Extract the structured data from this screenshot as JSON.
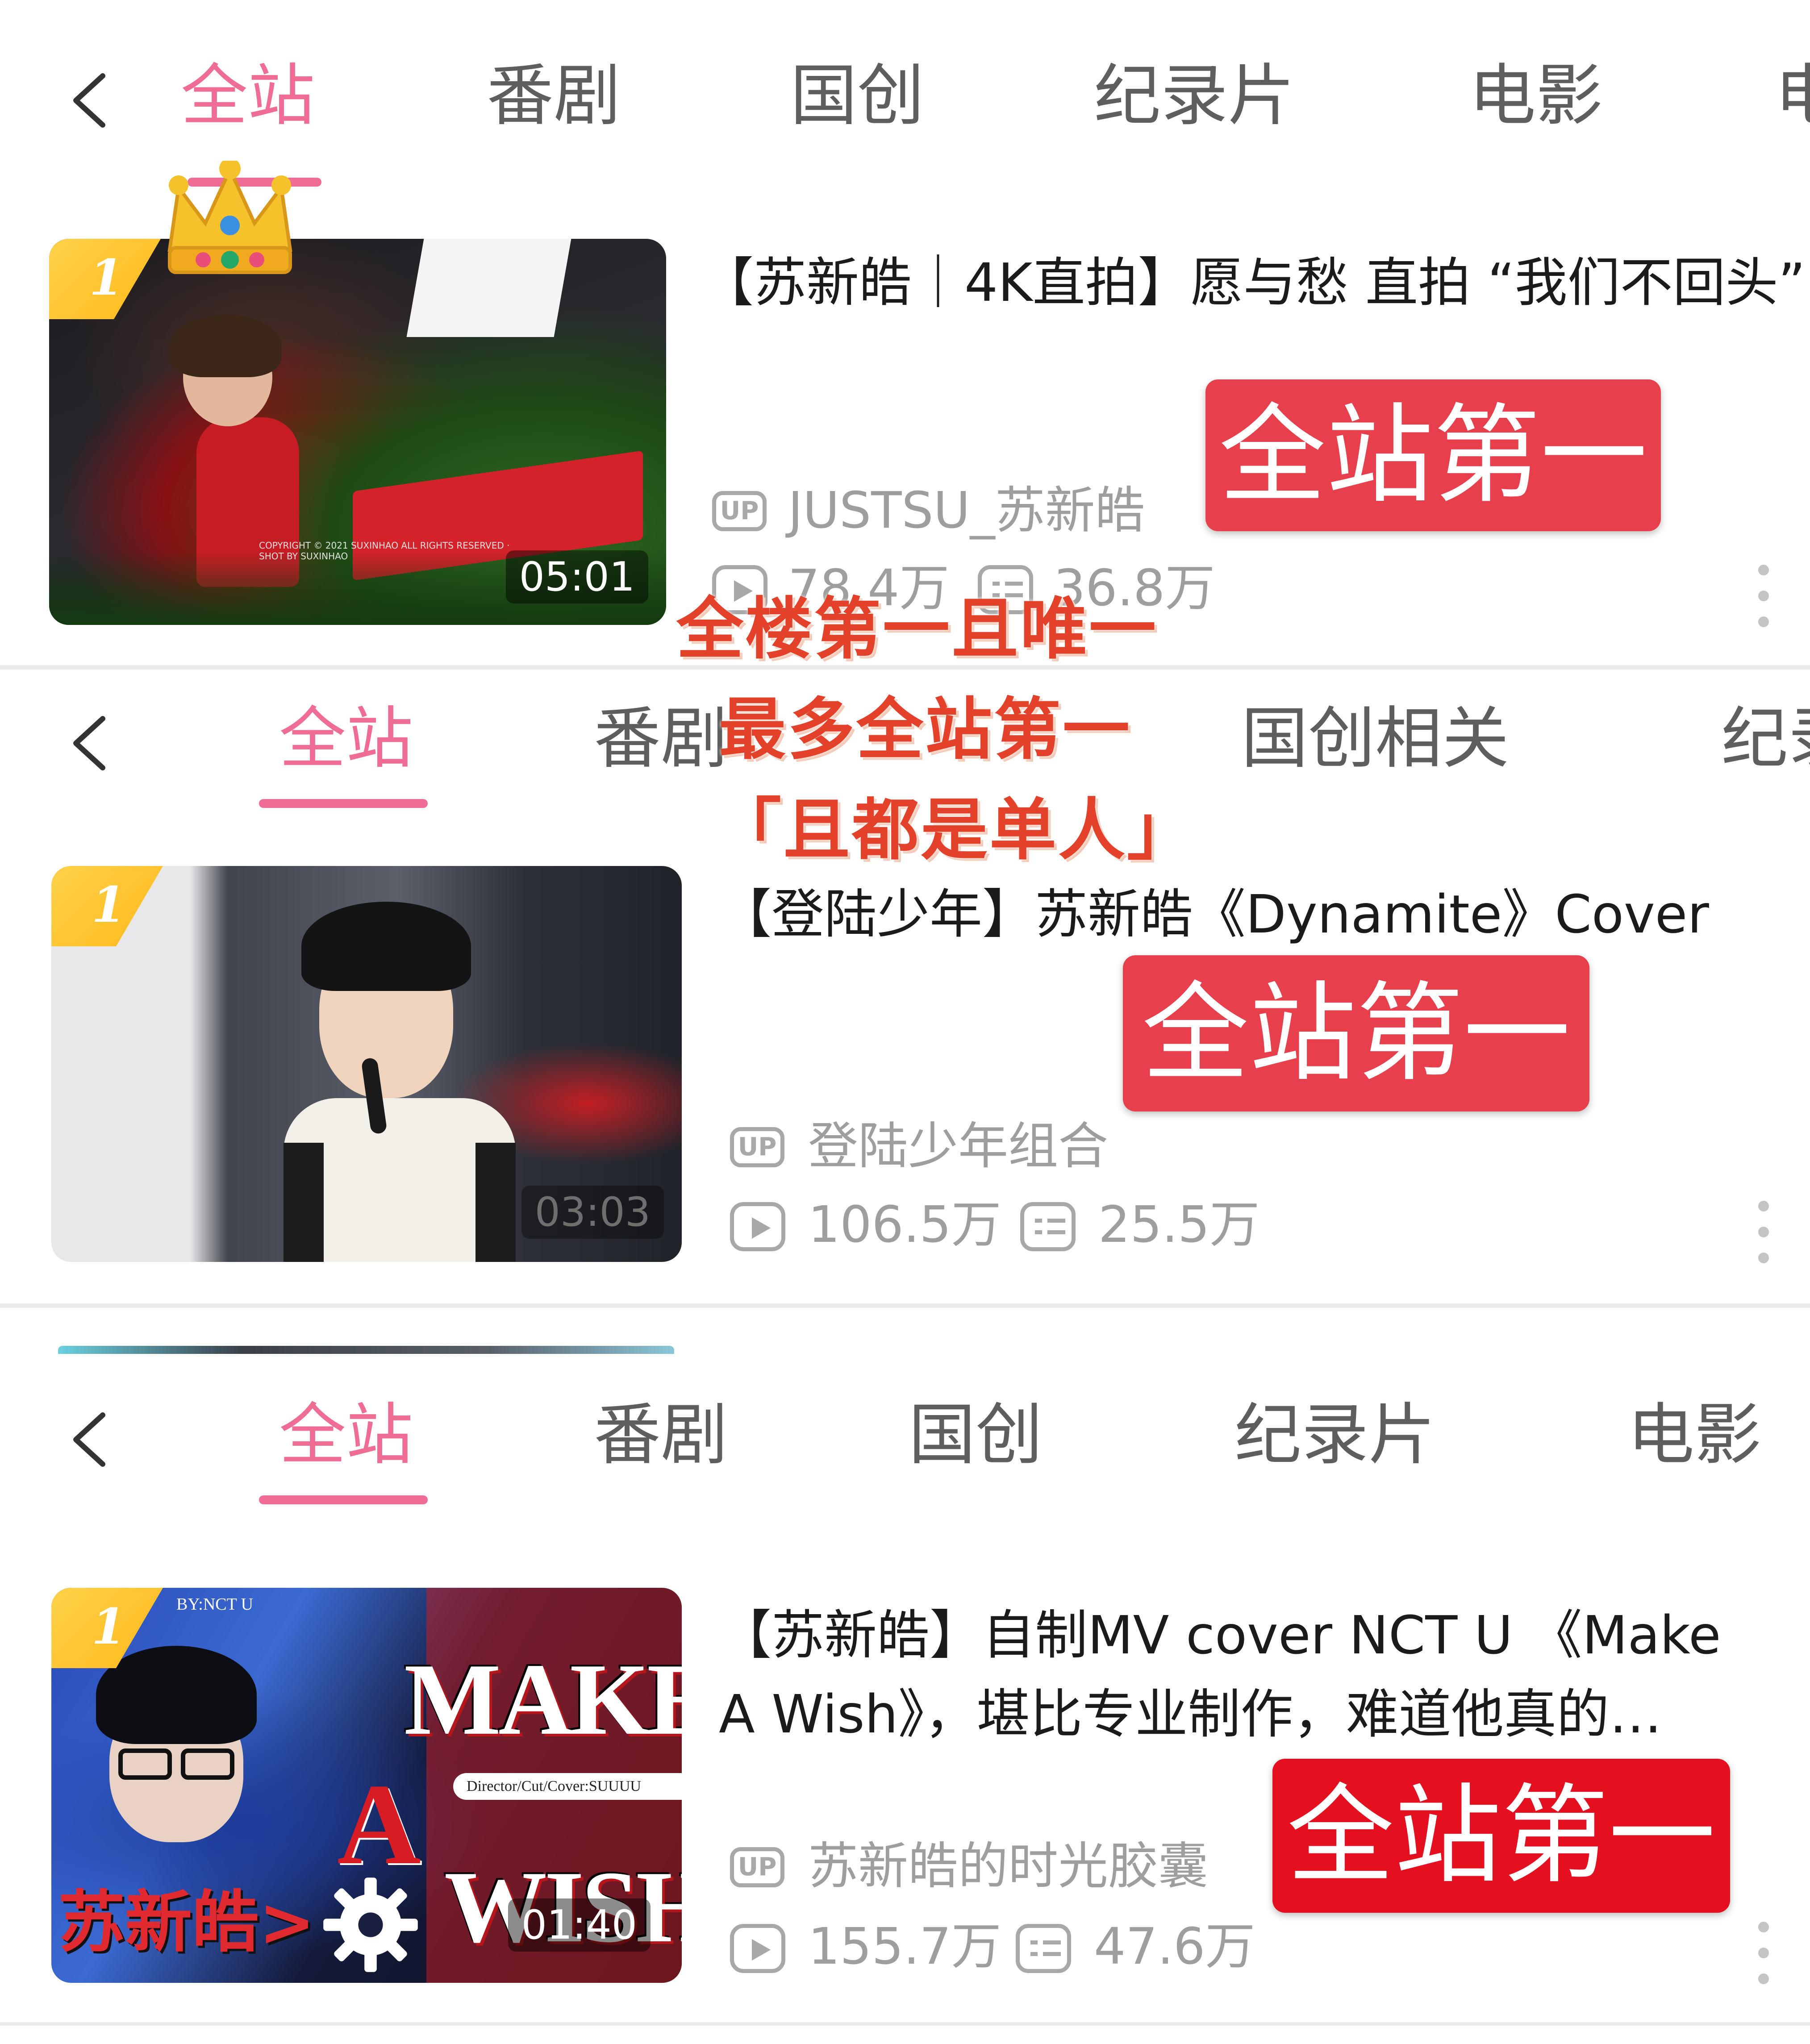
{
  "nav": {
    "tabs_panel1": [
      "全站",
      "番剧",
      "国创",
      "纪录片",
      "电影",
      "电"
    ],
    "tabs_panel2": [
      "全站",
      "番剧",
      "国创相关",
      "纪录"
    ],
    "tabs_panel3": [
      "全站",
      "番剧",
      "国创",
      "纪录片",
      "电影"
    ]
  },
  "videos": [
    {
      "rank": "1",
      "title": "【苏新皓｜4K直拍】愿与愁 直拍 “我们不回头”",
      "uploader": "JUSTSU_苏新皓",
      "views": "78.4万",
      "danmaku": "36.8万",
      "duration": "05:01",
      "thumb_caption": "COPYRIGHT © 2021 SUXINHAO ALL RIGHTS RESERVED · SHOT BY SUXINHAO"
    },
    {
      "rank": "1",
      "title": "【登陆少年】苏新皓《Dynamite》Cover",
      "uploader": "登陆少年组合",
      "views": "106.5万",
      "danmaku": "25.5万",
      "duration": "03:03"
    },
    {
      "rank": "1",
      "title_line1": "【苏新皓】自制MV cover NCT U 《Make",
      "title_line2": "A Wish》，堪比专业制作，难道他真的…",
      "uploader": "苏新皓的时光胶囊",
      "views": "155.7万",
      "danmaku": "47.6万",
      "duration": "01:40",
      "thumb_text": {
        "by": "BY:NCT U",
        "make": "MAKE",
        "a": "A",
        "wish": "WISH",
        "credit": "Director/Cut/Cover:SUUUU",
        "name": "苏新皓>"
      }
    }
  ],
  "annotations": {
    "stamp": "全站第一",
    "line1": "全楼第一且唯一",
    "line2": "最多全站第一",
    "line3": "「且都是单人」"
  },
  "colors": {
    "accent_pink": "#ef6d95",
    "stamp_red": "#e73f4c",
    "stamp_red_bright": "#e5101f",
    "overlay_text_red": "#e4412b",
    "badge_gold": "#ffbe1f"
  },
  "icons": [
    "back-chevron-icon",
    "crown-icon",
    "up-icon",
    "play-count-icon",
    "danmaku-icon",
    "more-dots-icon",
    "gear-icon"
  ]
}
